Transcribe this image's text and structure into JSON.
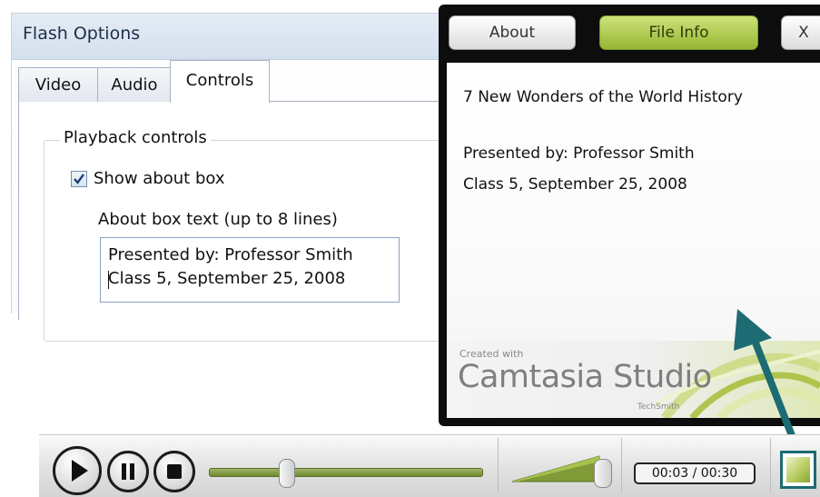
{
  "dialog": {
    "title": "Flash Options",
    "tabs": [
      {
        "label": "Video",
        "selected": false
      },
      {
        "label": "Audio",
        "selected": false
      },
      {
        "label": "Controls",
        "selected": true
      }
    ],
    "group_label": "Playback controls",
    "show_about_checkbox": {
      "label": "Show about box",
      "checked": true
    },
    "about_text_label": "About box text (up to 8 lines)",
    "about_text_lines": [
      "Presented by: Professor Smith",
      "Class 5, September 25, 2008"
    ]
  },
  "about_panel": {
    "buttons": {
      "about": "About",
      "file_info": "File Info",
      "close": "X"
    },
    "title_line": "7 New Wonders of the World History",
    "lines": [
      "Presented by: Professor Smith",
      "Class 5, September 25, 2008"
    ],
    "branding": {
      "created_with": "Created with",
      "product": "Camtasia Studio",
      "maker": "TechSmith"
    }
  },
  "player": {
    "time_display": "00:03 / 00:30",
    "progress_fraction": 0.28,
    "volume_fraction": 0.95
  },
  "colors": {
    "accent_green": "#a7c43c",
    "arrow_teal": "#1d6b73",
    "panel_black": "#0d0d0d"
  },
  "icons": {
    "play": "play-icon",
    "pause": "pause-icon",
    "stop": "stop-icon",
    "volume": "volume-slider",
    "info": "info-toggle-icon"
  }
}
